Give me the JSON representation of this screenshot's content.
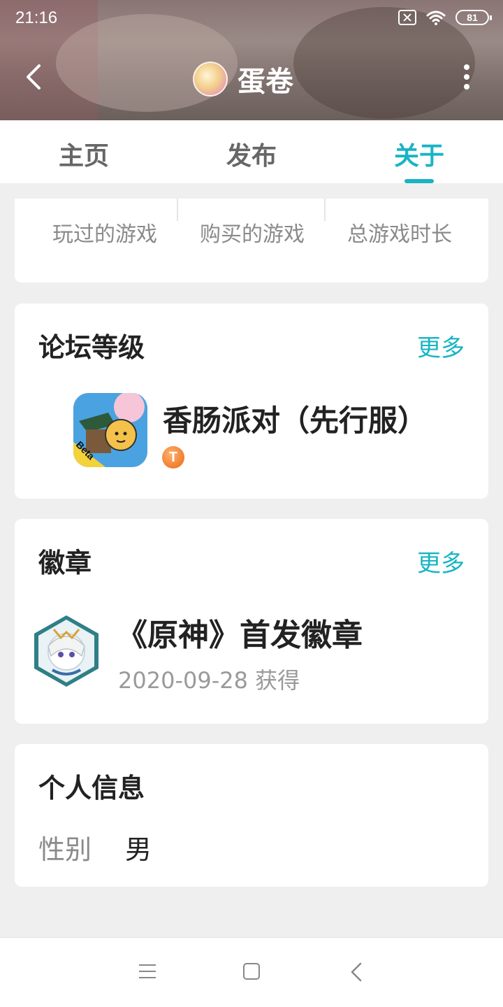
{
  "status": {
    "time": "21:16",
    "battery": "81"
  },
  "header": {
    "title": "蛋卷"
  },
  "tabs": [
    {
      "label": "主页"
    },
    {
      "label": "发布"
    },
    {
      "label": "关于"
    }
  ],
  "stats": [
    {
      "label": "玩过的游戏"
    },
    {
      "label": "购买的游戏"
    },
    {
      "label": "总游戏时长"
    }
  ],
  "forum": {
    "title": "论坛等级",
    "more": "更多",
    "game_name": "香肠派对（先行服）",
    "game_icon_badge": "Beta",
    "level_badge": "T"
  },
  "badges": {
    "title": "徽章",
    "more": "更多",
    "badge_name": "《原神》首发徽章",
    "badge_date": "2020-09-28 获得"
  },
  "info": {
    "title": "个人信息",
    "gender_label": "性别",
    "gender_value": "男"
  },
  "colors": {
    "accent": "#19b4c4",
    "text": "#222222",
    "muted": "#8a8a8a",
    "background": "#efefef"
  }
}
